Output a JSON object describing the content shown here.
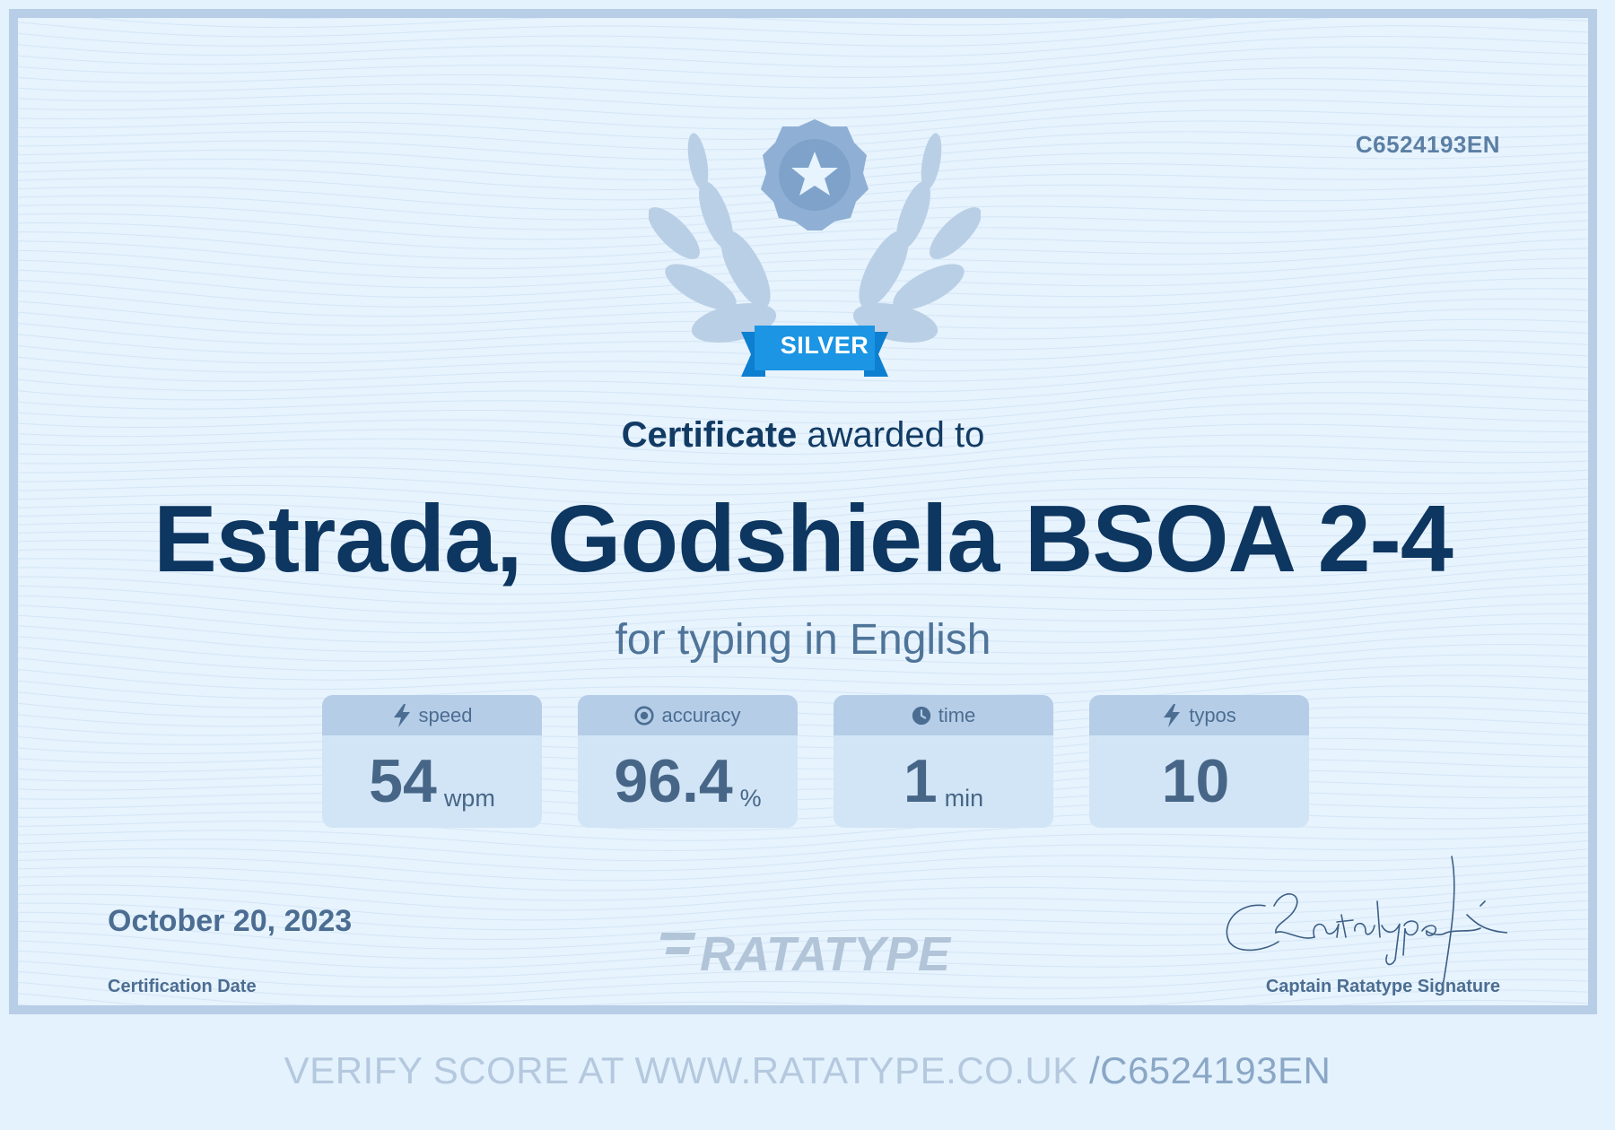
{
  "certificate": {
    "code": "C6524193EN",
    "badge_label": "SILVER",
    "headline_strong": "Certificate",
    "headline_rest": "awarded to",
    "recipient_name": "Estrada, Godshiela BSOA 2-4",
    "subtitle": "for typing in English",
    "stats": [
      {
        "label": "speed",
        "value": "54",
        "unit": "wpm",
        "icon": "lightning-icon"
      },
      {
        "label": "accuracy",
        "value": "96.4",
        "unit": "%",
        "icon": "target-icon"
      },
      {
        "label": "time",
        "value": "1",
        "unit": "min",
        "icon": "clock-icon"
      },
      {
        "label": "typos",
        "value": "10",
        "unit": "",
        "icon": "lightning-icon"
      }
    ],
    "date": "October 20, 2023",
    "date_label": "Certification Date",
    "brand_logo_text": "RATATYPE",
    "signature_text": "CRatatype",
    "signature_label": "Captain Ratatype Signature"
  },
  "footer": {
    "verify_text": "VERIFY SCORE AT WWW.RATATYPE.CO.UK",
    "verify_code": "/C6524193EN"
  },
  "colors": {
    "name": "#0d3660",
    "badge": "#1b95e4",
    "emblem": "#8fb0d4"
  }
}
